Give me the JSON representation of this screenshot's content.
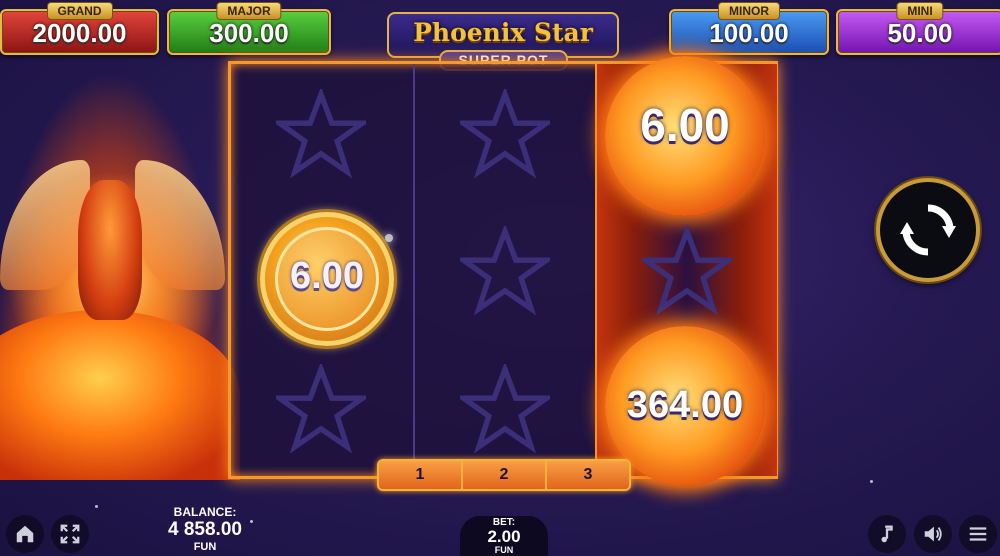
{
  "jackpots": {
    "grand": {
      "label": "GRAND",
      "value": "2000.00"
    },
    "major": {
      "label": "MAJOR",
      "value": "300.00"
    },
    "minor": {
      "label": "MINOR",
      "value": "100.00"
    },
    "mini": {
      "label": "MINI",
      "value": "50.00"
    }
  },
  "logo": {
    "title": "Phoenix Star",
    "subtitle": "SUPER POT"
  },
  "reels": {
    "coin_value": "6.00",
    "sun_top_value": "6.00",
    "sun_bottom_value": "364.00"
  },
  "lines": [
    "1",
    "2",
    "3"
  ],
  "balance": {
    "label": "BALANCE:",
    "value": "4 858.00",
    "currency": "FUN"
  },
  "bet": {
    "label": "BET:",
    "value": "2.00",
    "currency": "FUN"
  },
  "icons": {
    "home": "home-icon",
    "fullscreen": "fullscreen-icon",
    "spin": "spin-icon",
    "music": "music-icon",
    "sound": "sound-icon",
    "menu": "menu-icon"
  },
  "colors": {
    "accent": "#f39a2a",
    "gold": "#e3b447",
    "background": "#271a55"
  }
}
